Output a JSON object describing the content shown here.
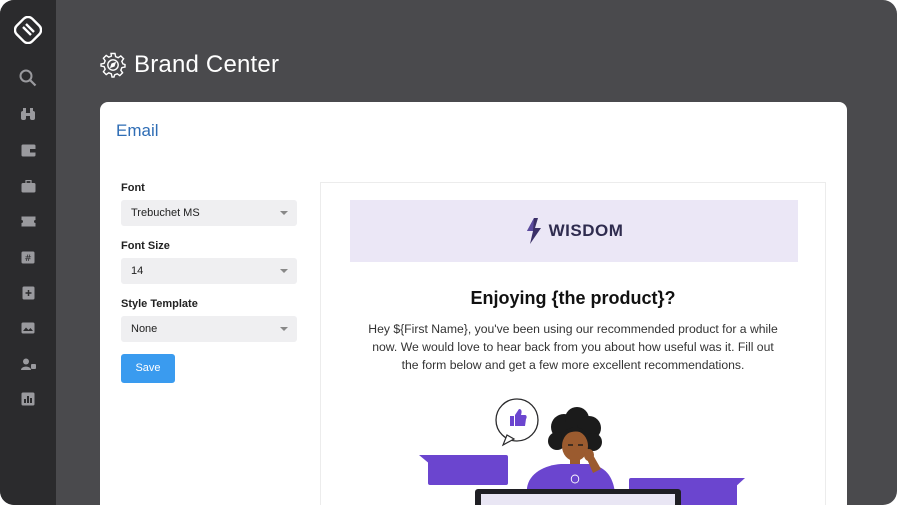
{
  "app": {
    "page_title": "Brand Center"
  },
  "sidebar": {
    "items": [
      {
        "icon": "search-icon"
      },
      {
        "icon": "binoculars-icon"
      },
      {
        "icon": "wallet-icon"
      },
      {
        "icon": "briefcase-icon"
      },
      {
        "icon": "ticket-icon"
      },
      {
        "icon": "hashtag-icon"
      },
      {
        "icon": "add-document-icon"
      },
      {
        "icon": "image-icon"
      },
      {
        "icon": "users-icon"
      },
      {
        "icon": "chart-report-icon"
      }
    ]
  },
  "card": {
    "title": "Email"
  },
  "form": {
    "font_label": "Font",
    "font_value": "Trebuchet MS",
    "font_size_label": "Font Size",
    "font_size_value": "14",
    "style_template_label": "Style Template",
    "style_template_value": "None",
    "save_label": "Save"
  },
  "preview": {
    "brand_name": "WISDOM",
    "heading": "Enjoying {the product}?",
    "body": "Hey ${First Name}, you've been using our recommended product for a while now. We would love to hear back from you about how useful was it. Fill out the form below and get a few more excellent recommendations."
  },
  "colors": {
    "sidebar_bg": "#2b2b2d",
    "main_bg": "#4a4a4d",
    "accent_blue": "#3a9bef",
    "title_blue": "#2f6db5",
    "banner_bg": "#ebe7f6",
    "illustration_purple": "#6b45cf"
  }
}
